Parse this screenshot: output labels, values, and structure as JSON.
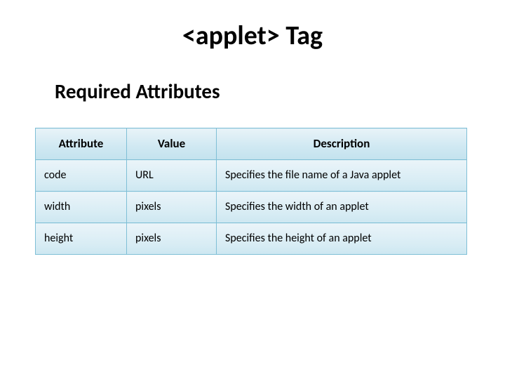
{
  "title": "<applet> Tag",
  "subtitle": "Required Attributes",
  "table": {
    "headers": {
      "attribute": "Attribute",
      "value": "Value",
      "description": "Description"
    },
    "rows": [
      {
        "attribute": "code",
        "value": "URL",
        "description": "Specifies the file name of a Java applet"
      },
      {
        "attribute": "width",
        "value": "pixels",
        "description": "Specifies the width of an applet"
      },
      {
        "attribute": "height",
        "value": "pixels",
        "description": "Specifies the height of an applet"
      }
    ]
  }
}
